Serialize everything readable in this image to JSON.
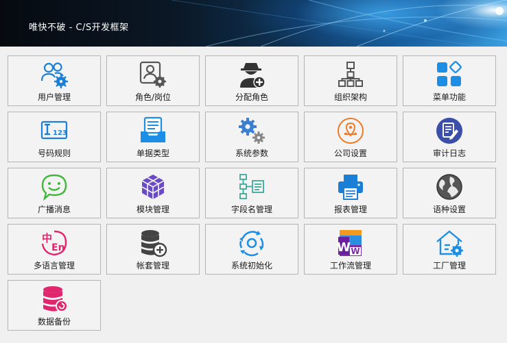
{
  "window": {
    "title": "唯快不破 - C/S开发框架"
  },
  "tiles": [
    {
      "label": "用户管理",
      "icon": "users-gear-icon"
    },
    {
      "label": "角色/岗位",
      "icon": "role-card-icon"
    },
    {
      "label": "分配角色",
      "icon": "assign-role-icon"
    },
    {
      "label": "组织架构",
      "icon": "org-chart-icon"
    },
    {
      "label": "菜单功能",
      "icon": "menu-blocks-icon"
    },
    {
      "label": "号码规则",
      "icon": "number-rule-icon"
    },
    {
      "label": "单据类型",
      "icon": "document-tray-icon"
    },
    {
      "label": "系统参数",
      "icon": "gears-icon"
    },
    {
      "label": "公司设置",
      "icon": "location-pin-icon"
    },
    {
      "label": "审计日志",
      "icon": "audit-log-icon"
    },
    {
      "label": "广播消息",
      "icon": "chat-bubble-icon"
    },
    {
      "label": "模块管理",
      "icon": "cube-module-icon"
    },
    {
      "label": "字段名管理",
      "icon": "field-tree-icon"
    },
    {
      "label": "报表管理",
      "icon": "printer-icon"
    },
    {
      "label": "语种设置",
      "icon": "globe-icon"
    },
    {
      "label": "多语言管理",
      "icon": "chinese-english-icon"
    },
    {
      "label": "帐套管理",
      "icon": "database-add-icon"
    },
    {
      "label": "系统初始化",
      "icon": "refresh-cycle-icon"
    },
    {
      "label": "工作流管理",
      "icon": "workflow-w-icon"
    },
    {
      "label": "工厂管理",
      "icon": "factory-home-icon"
    },
    {
      "label": "数据备份",
      "icon": "database-backup-icon"
    }
  ]
}
